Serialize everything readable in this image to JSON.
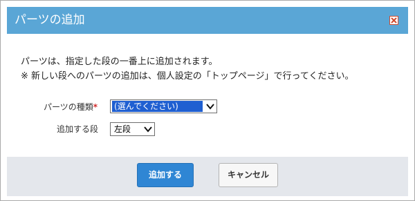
{
  "dialog": {
    "title": "パーツの追加",
    "description_line1": "パーツは、指定した段の一番上に追加されます。",
    "description_line2": "※ 新しい段へのパーツの追加は、個人設定の「トップページ」で行ってください。"
  },
  "form": {
    "part_type_label": "パーツの種類",
    "part_type_required_mark": "*",
    "part_type_value": "(選んでください)",
    "column_label": "追加する段",
    "column_value": "左段"
  },
  "buttons": {
    "add_label": "追加する",
    "cancel_label": "キャンセル"
  },
  "colors": {
    "titlebar": "#5aa6d6",
    "primary_button": "#2f86d4",
    "required": "#d12b2b",
    "footer": "#e4e7ec"
  },
  "icons": {
    "close": "close-icon",
    "dropdown": "chevron-down-icon"
  }
}
